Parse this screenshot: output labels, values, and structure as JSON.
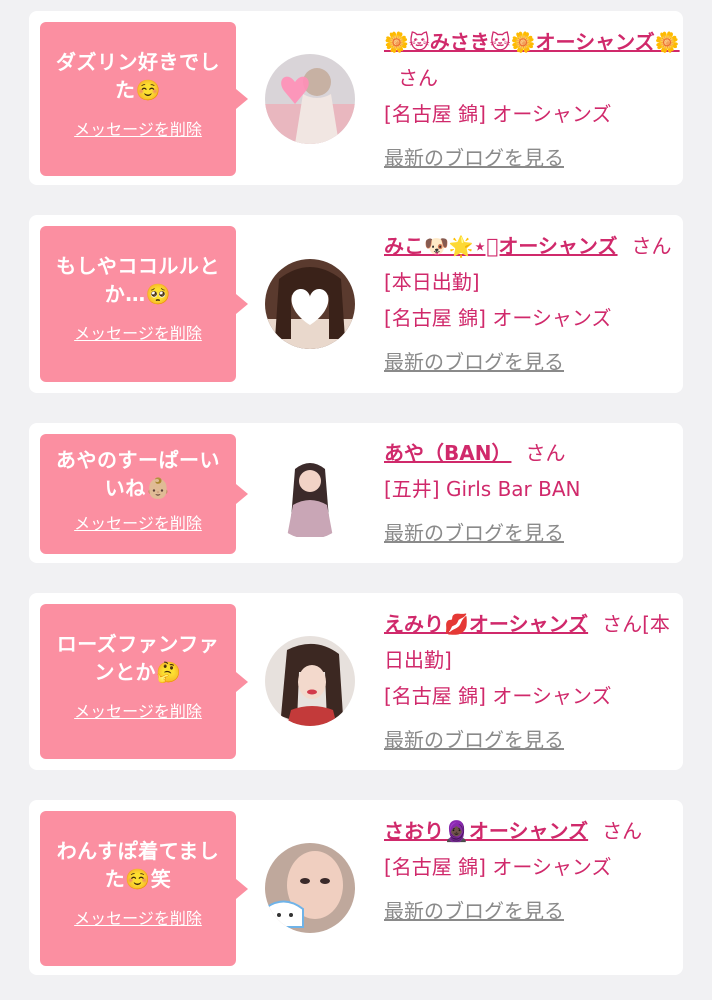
{
  "messages": [
    {
      "comment": "ダズリン好きでした☺️",
      "delete_label": "メッセージを削除",
      "name": "🌼🐱みさき🐱🌼オーシャンズ🌼",
      "honorific": "さん",
      "status": "",
      "shop": "[名古屋 錦] オーシャンズ",
      "blog_label": "最新のブログを見る",
      "avatar": "photo-avatar-pink-heart"
    },
    {
      "comment": "もしやココルルとか…🥺",
      "delete_label": "メッセージを削除",
      "name": "みこ🐶🌟⋆͛オーシャンズ",
      "honorific": "さん",
      "status": "[本日出勤]",
      "shop": "[名古屋 錦] オーシャンズ",
      "blog_label": "最新のブログを見る",
      "avatar": "photo-avatar-heart-face"
    },
    {
      "comment": "あやのすーぱーいいね👶🏼",
      "delete_label": "メッセージを削除",
      "name": "あや（BAN）",
      "honorific": "さん",
      "status": "",
      "shop": "[五井] Girls Bar BAN",
      "blog_label": "最新のブログを見る",
      "avatar": "photo-avatar-girl"
    },
    {
      "comment": "ローズファンファンとか🤔",
      "delete_label": "メッセージを削除",
      "name": "えみり💋オーシャンズ",
      "honorific": "さん",
      "status": "[本日出勤]",
      "shop": "[名古屋 錦] オーシャンズ",
      "blog_label": "最新のブログを見る",
      "avatar": "photo-avatar-selfie"
    },
    {
      "comment": "わんすぽ着てました☺️笑",
      "delete_label": "メッセージを削除",
      "name": "さおり🧕🏿オーシャンズ",
      "honorific": "さん",
      "status": "",
      "shop": "[名古屋 錦] オーシャンズ",
      "blog_label": "最新のブログを見る",
      "avatar": "photo-avatar-cat-sticker"
    }
  ],
  "colors": {
    "bubble": "#fb8fa1",
    "accent": "#d0296b",
    "link_gray": "#8a8a8a",
    "background": "#f1f1f3"
  }
}
